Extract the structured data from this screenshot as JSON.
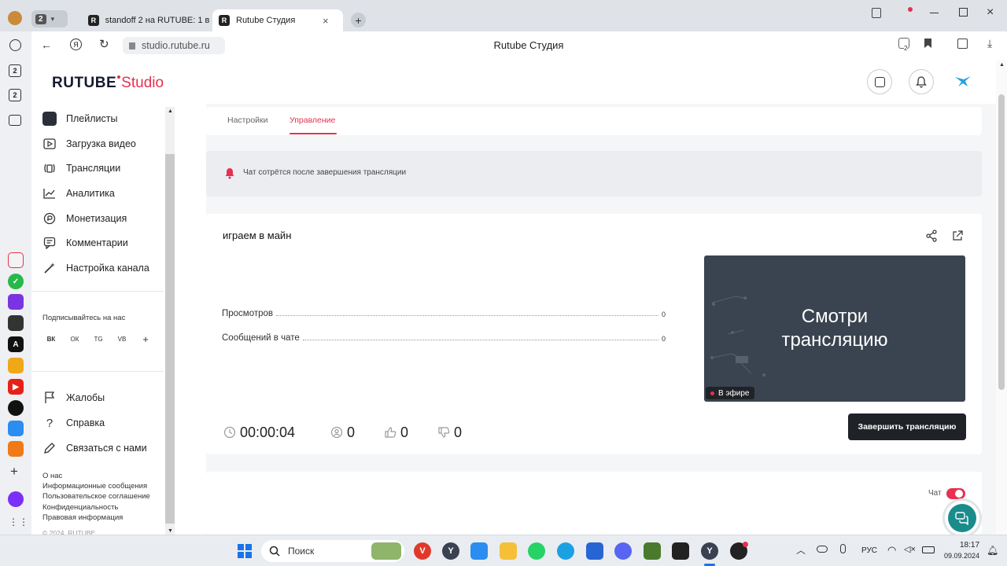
{
  "browser": {
    "tab_counter": "2",
    "tabs": [
      {
        "label": "standoff 2 на RUTUBE: 1 в",
        "favicon": "R"
      },
      {
        "label": "Rutube Студия",
        "favicon": "R"
      }
    ],
    "url": "studio.rutube.ru",
    "page_title": "Rutube Студия",
    "downloads_badge": "2"
  },
  "browser_sidebar": {
    "badges": [
      "2",
      "2"
    ]
  },
  "studio": {
    "logo_main": "RUTUBE",
    "logo_accent": "Studio",
    "nav": [
      {
        "label": "Плейлисты",
        "icon": "playlist-icon"
      },
      {
        "label": "Загрузка видео",
        "icon": "upload-icon"
      },
      {
        "label": "Трансляции",
        "icon": "broadcast-icon"
      },
      {
        "label": "Аналитика",
        "icon": "analytics-icon"
      },
      {
        "label": "Монетизация",
        "icon": "money-icon"
      },
      {
        "label": "Комментарии",
        "icon": "comments-icon"
      },
      {
        "label": "Настройка канала",
        "icon": "wand-icon"
      }
    ],
    "subscribe_title": "Подписывайтесь на нас",
    "socials": [
      "ВК",
      "ОК",
      "TG",
      "VB",
      "+"
    ],
    "nav_secondary": [
      {
        "label": "Жалобы",
        "icon": "flag-icon"
      },
      {
        "label": "Справка",
        "icon": "help-icon"
      },
      {
        "label": "Связаться с нами",
        "icon": "pen-icon"
      }
    ],
    "footer_links": [
      "О нас",
      "Информационные сообщения",
      "Пользовательское соглашение",
      "Конфиденциальность",
      "Правовая информация",
      "© 2024, RUTUBE"
    ],
    "tabs": [
      "Настройки",
      "Управление"
    ],
    "active_tab": "Управление",
    "notice": "Чат сотрётся после завершения трансляции",
    "stream": {
      "title": "играем в майн",
      "stats": [
        {
          "label": "Просмотров",
          "value": "0"
        },
        {
          "label": "Сообщений в чате",
          "value": "0"
        }
      ],
      "preview_text_line1": "Смотри",
      "preview_text_line2": "трансляцию",
      "live_badge": "В эфире",
      "duration": "00:00:04",
      "viewers": "0",
      "likes": "0",
      "dislikes": "0",
      "end_button": "Завершить трансляцию"
    },
    "chat_label": "Чат",
    "chat_enabled": true
  },
  "taskbar": {
    "search_placeholder": "Поиск",
    "language": "РУС",
    "time": "18:17",
    "date": "09.09.2024"
  },
  "colors": {
    "accent": "#e8304f",
    "dark_button": "#1f2328",
    "preview_bg": "#3a4450",
    "support_bubble": "#1a8c8c"
  }
}
